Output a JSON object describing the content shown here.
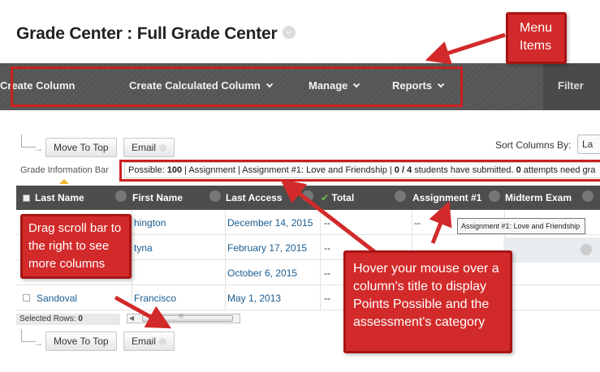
{
  "page": {
    "title": "Grade Center : Full Grade Center"
  },
  "menu": {
    "items": [
      {
        "label": "Create Column",
        "has_chevron": false
      },
      {
        "label": "Create Calculated Column",
        "has_chevron": true
      },
      {
        "label": "Manage",
        "has_chevron": true
      },
      {
        "label": "Reports",
        "has_chevron": true
      }
    ],
    "filter_label": "Filter"
  },
  "toolbar": {
    "move_to_top_label": "Move To Top",
    "email_label": "Email",
    "sort_label": "Sort Columns By:",
    "sort_value": "La"
  },
  "info_bar": {
    "label": "Grade Information Bar",
    "prefix": "Possible: ",
    "points": "100",
    "mid1": " | Assignment | Assignment #1: Love and Friendship | ",
    "submitted": "0 / 4",
    "mid2": " students have submitted. ",
    "attempts": "0",
    "suffix": " attempts need gra"
  },
  "grid": {
    "columns": {
      "last_name": "Last Name",
      "first_name": "First Name",
      "last_access": "Last Access",
      "total": "Total",
      "assignment1": "Assignment #1",
      "midterm": "Midterm Exam"
    },
    "rows": [
      {
        "last": "",
        "first": "hington",
        "access": "December 14, 2015",
        "total": "--",
        "a1": "--"
      },
      {
        "last": "",
        "first": "tyna",
        "access": "February 17, 2015",
        "total": "--",
        "a1": ""
      },
      {
        "last": "",
        "first": "",
        "access": "October 6, 2015",
        "total": "--",
        "a1": ""
      },
      {
        "last": "Sandoval",
        "first": "Francisco",
        "access": "May 1, 2013",
        "total": "--",
        "a1": ""
      }
    ],
    "selected_rows_label": "Selected Rows:",
    "selected_rows_count": "0",
    "scroll_grip": "III"
  },
  "tooltip": "Assignment #1: Love and Friendship",
  "annotations": {
    "menu_items": [
      "Menu",
      "Items"
    ],
    "drag": [
      "Drag scroll bar to",
      "the right to see",
      "more columns"
    ],
    "hover": [
      "Hover your mouse over a",
      "column's title to display",
      "Points Possible and the",
      "assessment's category"
    ]
  },
  "colors": {
    "accent_red": "#d22a2a",
    "menu_bg": "#555555",
    "header_bg": "#4d4d4d",
    "link": "#1a5c8f",
    "check_green": "#4caf50"
  },
  "icons": [
    "chevron-down-icon",
    "checkmark-icon",
    "checkbox-icon",
    "sort-arrow-icon",
    "column-menu-icon"
  ]
}
